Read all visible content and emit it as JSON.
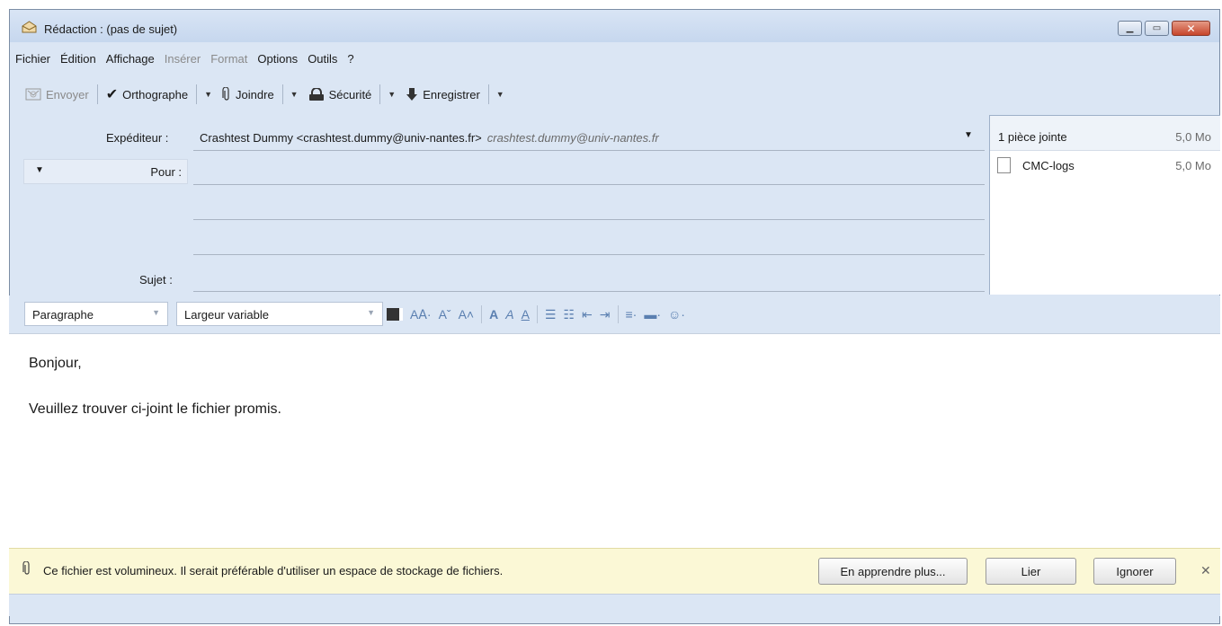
{
  "window": {
    "title": "Rédaction : (pas de sujet)"
  },
  "menu": {
    "items": [
      {
        "label": "Fichier",
        "disabled": false
      },
      {
        "label": "Édition",
        "disabled": false
      },
      {
        "label": "Affichage",
        "disabled": false
      },
      {
        "label": "Insérer",
        "disabled": true
      },
      {
        "label": "Format",
        "disabled": true
      },
      {
        "label": "Options",
        "disabled": false
      },
      {
        "label": "Outils",
        "disabled": false
      },
      {
        "label": "?",
        "disabled": false
      }
    ]
  },
  "toolbar": {
    "send_label": "Envoyer",
    "spell_label": "Orthographe",
    "attach_label": "Joindre",
    "security_label": "Sécurité",
    "save_label": "Enregistrer"
  },
  "header": {
    "from_label": "Expéditeur :",
    "from_value": "Crashtest Dummy <crashtest.dummy@univ-nantes.fr>",
    "from_identity": "crashtest.dummy@univ-nantes.fr",
    "to_label": "Pour :",
    "to_value": "",
    "subject_label": "Sujet :",
    "subject_value": ""
  },
  "attachments": {
    "count_label": "1 pièce jointe",
    "total_size": "5,0 Mo",
    "files": [
      {
        "name": "CMC-logs",
        "size": "5,0 Mo"
      }
    ]
  },
  "format": {
    "paragraph_value": "Paragraphe",
    "font_value": "Largeur variable"
  },
  "body": {
    "lines": [
      "Bonjour,",
      "Veuillez trouver ci-joint le fichier promis."
    ]
  },
  "notification": {
    "message": "Ce fichier est volumineux. Il serait préférable d'utiliser un espace de stockage de fichiers.",
    "learn_more": "En apprendre plus...",
    "link": "Lier",
    "ignore": "Ignorer"
  },
  "colors": {
    "chrome": "#dbe6f4",
    "notification_bg": "#fbf8d6",
    "close_button": "#c7452a"
  }
}
